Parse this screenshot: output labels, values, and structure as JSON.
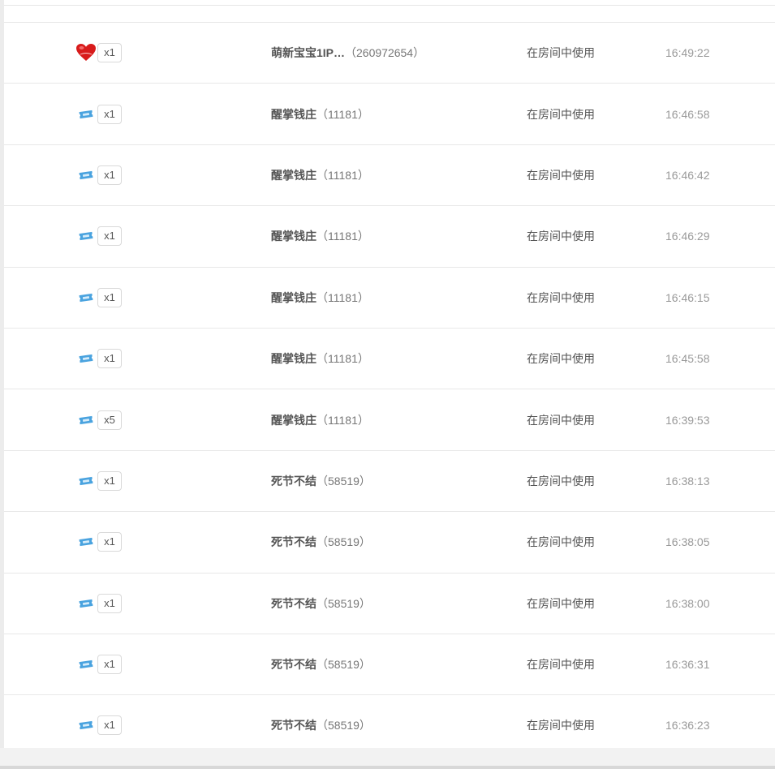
{
  "colors": {
    "heart": "#d81b1b",
    "ticket": "#4aa3df",
    "time_text": "#999999",
    "name_text": "#555555"
  },
  "rows": [
    {
      "icon": "heart-icon",
      "qty": "x1",
      "name": "萌新宝宝1IP…",
      "id": "（260972654）",
      "usage": "在房间中使用",
      "time": "16:49:22"
    },
    {
      "icon": "ticket-icon",
      "qty": "x1",
      "name": "醒掌钱庄",
      "id": "（11181）",
      "usage": "在房间中使用",
      "time": "16:46:58"
    },
    {
      "icon": "ticket-icon",
      "qty": "x1",
      "name": "醒掌钱庄",
      "id": "（11181）",
      "usage": "在房间中使用",
      "time": "16:46:42"
    },
    {
      "icon": "ticket-icon",
      "qty": "x1",
      "name": "醒掌钱庄",
      "id": "（11181）",
      "usage": "在房间中使用",
      "time": "16:46:29"
    },
    {
      "icon": "ticket-icon",
      "qty": "x1",
      "name": "醒掌钱庄",
      "id": "（11181）",
      "usage": "在房间中使用",
      "time": "16:46:15"
    },
    {
      "icon": "ticket-icon",
      "qty": "x1",
      "name": "醒掌钱庄",
      "id": "（11181）",
      "usage": "在房间中使用",
      "time": "16:45:58"
    },
    {
      "icon": "ticket-icon",
      "qty": "x5",
      "name": "醒掌钱庄",
      "id": "（11181）",
      "usage": "在房间中使用",
      "time": "16:39:53"
    },
    {
      "icon": "ticket-icon",
      "qty": "x1",
      "name": "死节不结",
      "id": "（58519）",
      "usage": "在房间中使用",
      "time": "16:38:13"
    },
    {
      "icon": "ticket-icon",
      "qty": "x1",
      "name": "死节不结",
      "id": "（58519）",
      "usage": "在房间中使用",
      "time": "16:38:05"
    },
    {
      "icon": "ticket-icon",
      "qty": "x1",
      "name": "死节不结",
      "id": "（58519）",
      "usage": "在房间中使用",
      "time": "16:38:00"
    },
    {
      "icon": "ticket-icon",
      "qty": "x1",
      "name": "死节不结",
      "id": "（58519）",
      "usage": "在房间中使用",
      "time": "16:36:31"
    },
    {
      "icon": "ticket-icon",
      "qty": "x1",
      "name": "死节不结",
      "id": "（58519）",
      "usage": "在房间中使用",
      "time": "16:36:23"
    }
  ]
}
